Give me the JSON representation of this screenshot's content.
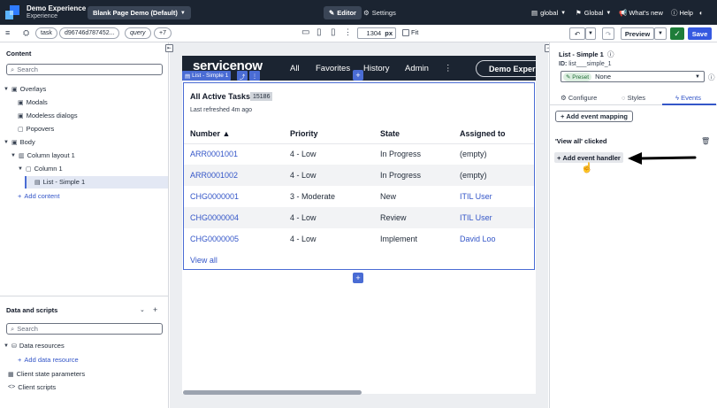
{
  "header": {
    "app_title": "Demo Experience",
    "app_subtitle": "Experience",
    "page_select": "Blank Page Demo (Default)",
    "editor_tab": "Editor",
    "settings_tab": "Settings",
    "scope_global": "global",
    "language_global": "Global",
    "whats_new": "What's new",
    "help": "Help"
  },
  "toolbar": {
    "pill_table": "task",
    "pill_sys_id": "d96746d787452...",
    "pill_query": "query",
    "pill_more": "+7",
    "zoom_value": "1304",
    "zoom_unit": "px",
    "fit_label": "Fit",
    "preview": "Preview",
    "save": "Save"
  },
  "content_panel": {
    "title": "Content",
    "search_placeholder": "Search",
    "tree": {
      "overlays": "Overlays",
      "modals": "Modals",
      "modeless_dialogs": "Modeless dialogs",
      "popovers": "Popovers",
      "body": "Body",
      "column_layout": "Column layout 1",
      "column": "Column 1",
      "list_simple": "List - Simple 1",
      "add_content": "Add content"
    }
  },
  "data_panel": {
    "title": "Data and scripts",
    "search_placeholder": "Search",
    "data_resources": "Data resources",
    "add_data_resource": "Add data resource",
    "client_state_parameters": "Client state parameters",
    "client_scripts": "Client scripts"
  },
  "canvas": {
    "nav": {
      "logo": "servicenow",
      "links": [
        "All",
        "Favorites",
        "History",
        "Admin"
      ],
      "demo": "Demo Experie"
    },
    "selection_tag": "List - Simple 1",
    "list": {
      "title": "All Active Tasks",
      "count": "15186",
      "refreshed": "Last refreshed 4m ago",
      "columns": [
        "Number ▲",
        "Priority",
        "State",
        "Assigned to"
      ],
      "rows": [
        {
          "number": "ARR0001001",
          "priority": "4 - Low",
          "state": "In Progress",
          "assigned": "(empty)"
        },
        {
          "number": "ARR0001002",
          "priority": "4 - Low",
          "state": "In Progress",
          "assigned": "(empty)"
        },
        {
          "number": "CHG0000001",
          "priority": "3 - Moderate",
          "state": "New",
          "assigned": "ITIL User"
        },
        {
          "number": "CHG0000004",
          "priority": "4 - Low",
          "state": "Review",
          "assigned": "ITIL User"
        },
        {
          "number": "CHG0000005",
          "priority": "4 - Low",
          "state": "Implement",
          "assigned": "David Loo"
        }
      ],
      "view_all": "View all"
    }
  },
  "config_panel": {
    "component_title": "List - Simple 1",
    "id_label": "ID:",
    "id_value": "list___simple_1",
    "preset_label": "Preset",
    "preset_value": "None",
    "tabs": [
      "Configure",
      "Styles",
      "Events"
    ],
    "active_tab": "Events",
    "add_event_mapping": "Add event mapping",
    "event_name": "'View all' clicked",
    "add_event_handler": "Add event handler"
  },
  "colors": {
    "header_bg": "#1b2431",
    "accent": "#3456c8",
    "selection": "#4a6cd4",
    "save_bg": "#3559e0",
    "publish_bg": "#1e7d3a"
  }
}
